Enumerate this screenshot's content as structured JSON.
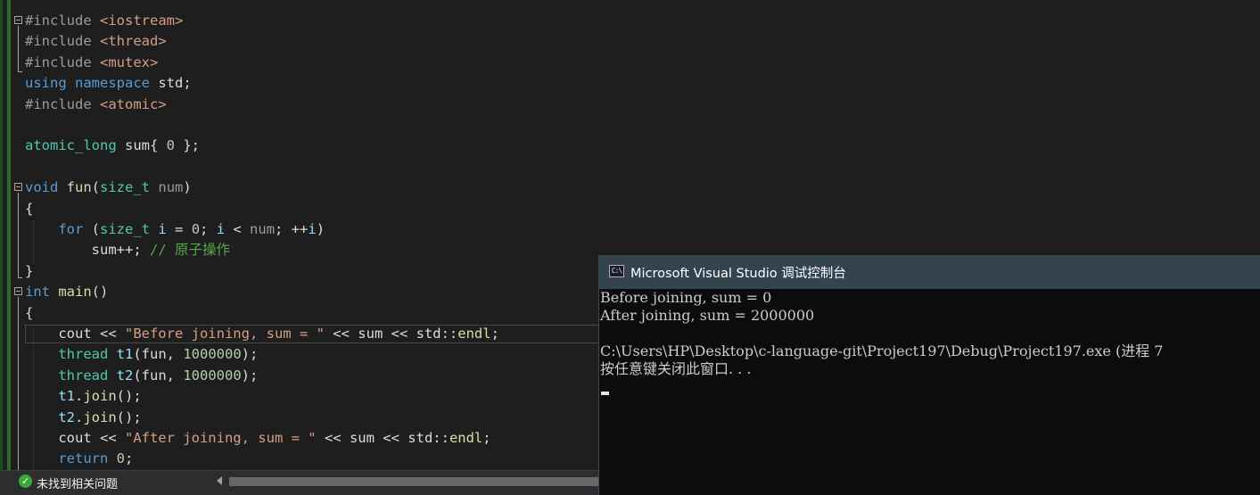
{
  "editor": {
    "lines": [
      [
        {
          "t": "#include ",
          "c": "pp"
        },
        {
          "t": "<iostream>",
          "c": "inc"
        }
      ],
      [
        {
          "t": "#include ",
          "c": "pp"
        },
        {
          "t": "<thread>",
          "c": "inc"
        }
      ],
      [
        {
          "t": "#include ",
          "c": "pp"
        },
        {
          "t": "<mutex>",
          "c": "inc"
        }
      ],
      [
        {
          "t": "using",
          "c": "kw"
        },
        {
          "t": " "
        },
        {
          "t": "namespace",
          "c": "kw"
        },
        {
          "t": " std;"
        }
      ],
      [
        {
          "t": "#include ",
          "c": "pp"
        },
        {
          "t": "<atomic>",
          "c": "inc"
        }
      ],
      [],
      [
        {
          "t": "atomic_long",
          "c": "ty"
        },
        {
          "t": " sum{ "
        },
        {
          "t": "0",
          "c": "num"
        },
        {
          "t": " };"
        }
      ],
      [],
      [
        {
          "t": "void",
          "c": "kw"
        },
        {
          "t": " "
        },
        {
          "t": "fun",
          "c": "fn"
        },
        {
          "t": "("
        },
        {
          "t": "size_t",
          "c": "ty"
        },
        {
          "t": " "
        },
        {
          "t": "num",
          "c": "par"
        },
        {
          "t": ")"
        }
      ],
      [
        {
          "t": "{"
        }
      ],
      [
        {
          "t": "    "
        },
        {
          "t": "for",
          "c": "kw"
        },
        {
          "t": " ("
        },
        {
          "t": "size_t",
          "c": "ty"
        },
        {
          "t": " "
        },
        {
          "t": "i",
          "c": "var"
        },
        {
          "t": " = "
        },
        {
          "t": "0",
          "c": "num"
        },
        {
          "t": "; "
        },
        {
          "t": "i",
          "c": "var"
        },
        {
          "t": " < "
        },
        {
          "t": "num",
          "c": "par"
        },
        {
          "t": "; ++"
        },
        {
          "t": "i",
          "c": "var"
        },
        {
          "t": ")"
        }
      ],
      [
        {
          "t": "        sum++; "
        },
        {
          "t": "// 原子操作",
          "c": "cm"
        }
      ],
      [
        {
          "t": "}"
        }
      ],
      [
        {
          "t": "int",
          "c": "kw"
        },
        {
          "t": " "
        },
        {
          "t": "main",
          "c": "fn"
        },
        {
          "t": "()"
        }
      ],
      [
        {
          "t": "{"
        }
      ],
      [
        {
          "t": "    cout << "
        },
        {
          "t": "\"Before joining, sum = \"",
          "c": "str"
        },
        {
          "t": " << sum << std::"
        },
        {
          "t": "endl",
          "c": "fn"
        },
        {
          "t": ";"
        }
      ],
      [
        {
          "t": "    "
        },
        {
          "t": "thread",
          "c": "ty"
        },
        {
          "t": " "
        },
        {
          "t": "t1",
          "c": "var"
        },
        {
          "t": "(fun, "
        },
        {
          "t": "1000000",
          "c": "num"
        },
        {
          "t": ");"
        }
      ],
      [
        {
          "t": "    "
        },
        {
          "t": "thread",
          "c": "ty"
        },
        {
          "t": " "
        },
        {
          "t": "t2",
          "c": "var"
        },
        {
          "t": "(fun, "
        },
        {
          "t": "1000000",
          "c": "num"
        },
        {
          "t": ");"
        }
      ],
      [
        {
          "t": "    "
        },
        {
          "t": "t1",
          "c": "var"
        },
        {
          "t": "."
        },
        {
          "t": "join",
          "c": "fn"
        },
        {
          "t": "();"
        }
      ],
      [
        {
          "t": "    "
        },
        {
          "t": "t2",
          "c": "var"
        },
        {
          "t": "."
        },
        {
          "t": "join",
          "c": "fn"
        },
        {
          "t": "();"
        }
      ],
      [
        {
          "t": "    cout << "
        },
        {
          "t": "\"After joining, sum = \"",
          "c": "str"
        },
        {
          "t": " << sum << std::"
        },
        {
          "t": "endl",
          "c": "fn"
        },
        {
          "t": ";"
        }
      ],
      [
        {
          "t": "    "
        },
        {
          "t": "return",
          "c": "kw"
        },
        {
          "t": " "
        },
        {
          "t": "0",
          "c": "num"
        },
        {
          "t": ";"
        }
      ]
    ],
    "fold_icon": "collapse-icon"
  },
  "statusbar": {
    "icon": "check-icon",
    "message": "未找到相关问题"
  },
  "console": {
    "title": "Microsoft Visual Studio 调试控制台",
    "icon_glyph": "C:\\",
    "icon_name": "console-app-icon",
    "lines": [
      "Before joining, sum = 0",
      "After joining, sum = 2000000",
      "",
      "C:\\Users\\HP\\Desktop\\c-language-git\\Project197\\Debug\\Project197.exe (进程 7",
      "按任意键关闭此窗口. . ."
    ]
  },
  "colors": {
    "editor_bg": "#1e1e1e",
    "console_bg": "#0c0c0c",
    "console_title_bg": "#33444e",
    "change_marker": "#2d6b2d"
  }
}
